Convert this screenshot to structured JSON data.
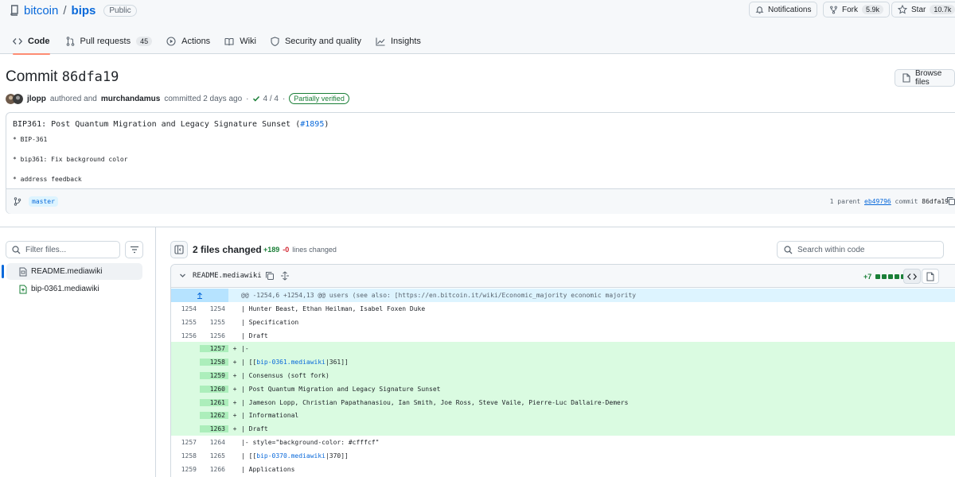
{
  "repo": {
    "owner": "bitcoin",
    "separator": "/",
    "name": "bips",
    "visibility": "Public"
  },
  "header_actions": {
    "notifications": "Notifications",
    "fork_label": "Fork",
    "fork_count": "5.9k",
    "star_label": "Star",
    "star_count": "10.7k"
  },
  "tabs": [
    {
      "label": "Code",
      "icon": "code-icon",
      "active": true
    },
    {
      "label": "Pull requests",
      "icon": "pull-request-icon",
      "count": "45"
    },
    {
      "label": "Actions",
      "icon": "play-icon"
    },
    {
      "label": "Wiki",
      "icon": "book-icon"
    },
    {
      "label": "Security and quality",
      "icon": "shield-icon"
    },
    {
      "label": "Insights",
      "icon": "graph-icon"
    }
  ],
  "commit": {
    "title_prefix": "Commit",
    "sha": "86dfa19",
    "browse_files": "Browse files",
    "author": "jlopp",
    "authored_text": "authored and",
    "committer": "murchandamus",
    "committed_text": "committed 2 days ago",
    "dot": "·",
    "checks": "4 / 4",
    "verified": "Partially verified",
    "message_title": "BIP361: Post Quantum Migration and Legacy Signature Sunset (",
    "message_pr": "#1895",
    "message_close": ")",
    "message_lines": [
      "* BIP-361",
      "* bip361: Fix background color",
      "* address feedback"
    ],
    "branch": "master",
    "parent_label": "1 parent",
    "parent_sha": "eb49796",
    "commit_label": "commit",
    "commit_sha": "86dfa19"
  },
  "file_tree": {
    "filter_placeholder": "Filter files...",
    "files": [
      {
        "name": "README.mediawiki",
        "icon": "file-diff-icon",
        "active": true
      },
      {
        "name": "bip-0361.mediawiki",
        "icon": "file-added-icon"
      }
    ]
  },
  "diff_summary": {
    "files_changed": "2 files changed",
    "additions": "+189",
    "deletions": "-0",
    "lines_changed": "lines changed",
    "search_placeholder": "Search within code"
  },
  "file": {
    "name": "README.mediawiki",
    "diffstat": "+7",
    "hunk_header": "@@ -1254,6 +1254,13 @@ users (see also: [https://en.bitcoin.it/wiki/Economic_majority economic majority",
    "rows": [
      {
        "type": "ctx",
        "old": "1254",
        "new": "1254",
        "sign": "",
        "code": "| Hunter Beast, Ethan Heilman, Isabel Foxen Duke"
      },
      {
        "type": "ctx",
        "old": "1255",
        "new": "1255",
        "sign": "",
        "code": "| Specification"
      },
      {
        "type": "ctx",
        "old": "1256",
        "new": "1256",
        "sign": "",
        "code": "| Draft"
      },
      {
        "type": "add",
        "old": "",
        "new": "1257",
        "sign": "+",
        "code": "|-"
      },
      {
        "type": "add",
        "old": "",
        "new": "1258",
        "sign": "+",
        "code_pre": "| [[",
        "link": "bip-0361.mediawiki",
        "code_post": "|361]]"
      },
      {
        "type": "add",
        "old": "",
        "new": "1259",
        "sign": "+",
        "code": "| Consensus (soft fork)"
      },
      {
        "type": "add",
        "old": "",
        "new": "1260",
        "sign": "+",
        "code": "| Post Quantum Migration and Legacy Signature Sunset"
      },
      {
        "type": "add",
        "old": "",
        "new": "1261",
        "sign": "+",
        "code": "| Jameson Lopp, Christian Papathanasiou, Ian Smith, Joe Ross, Steve Vaile, Pierre-Luc Dallaire-Demers"
      },
      {
        "type": "add",
        "old": "",
        "new": "1262",
        "sign": "+",
        "code": "| Informational"
      },
      {
        "type": "add",
        "old": "",
        "new": "1263",
        "sign": "+",
        "code": "| Draft"
      },
      {
        "type": "ctx",
        "old": "1257",
        "new": "1264",
        "sign": "",
        "code": "|- style=\"background-color: #cfffcf\""
      },
      {
        "type": "ctx",
        "old": "1258",
        "new": "1265",
        "sign": "",
        "code_pre": "| [[",
        "link": "bip-0370.mediawiki",
        "code_post": "|370]]"
      },
      {
        "type": "ctx",
        "old": "1259",
        "new": "1266",
        "sign": "",
        "code": "| Applications"
      }
    ]
  }
}
